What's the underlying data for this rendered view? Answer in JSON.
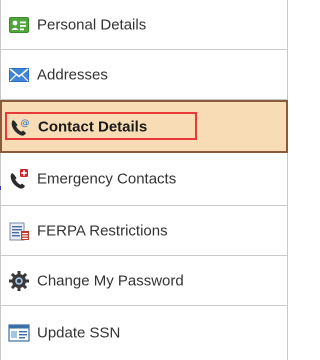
{
  "nav": {
    "items": [
      {
        "label": "Personal Details",
        "icon": "personal-details-icon",
        "selected": false
      },
      {
        "label": "Addresses",
        "icon": "envelope-icon",
        "selected": false
      },
      {
        "label": "Contact Details",
        "icon": "phone-at-icon",
        "selected": true
      },
      {
        "label": "Emergency Contacts",
        "icon": "phone-emergency-icon",
        "selected": false
      },
      {
        "label": "FERPA Restrictions",
        "icon": "ferpa-document-icon",
        "selected": false
      },
      {
        "label": "Change My Password",
        "icon": "gear-icon",
        "selected": false
      },
      {
        "label": "Update SSN",
        "icon": "ssn-window-icon",
        "selected": false
      }
    ]
  },
  "colors": {
    "selected_bg": "#f7dcb6",
    "selected_border": "#8a5a3c",
    "highlight_box": "#e8393a"
  }
}
